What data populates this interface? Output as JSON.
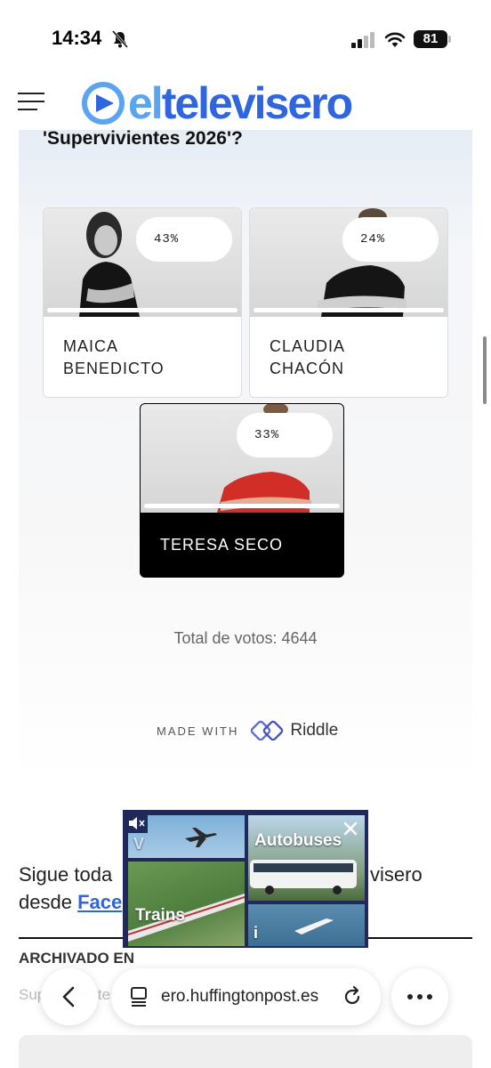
{
  "status_bar": {
    "time": "14:34",
    "battery": "81"
  },
  "header": {
    "logo_prefix": "el",
    "logo_main": "televisero"
  },
  "poll": {
    "title": "'Supervivientes 2026'?",
    "options": [
      {
        "line1": "MAICA",
        "line2": "BENEDICTO",
        "percent_label": "43%",
        "percent": 43
      },
      {
        "line1": "CLAUDIA",
        "line2": "CHACÓN",
        "percent_label": "24%",
        "percent": 24
      },
      {
        "line1": "TERESA SECO",
        "line2": "",
        "percent_label": "33%",
        "percent": 33,
        "selected": true
      }
    ],
    "total_votes": "Total de votos: 4644",
    "made_with": "MADE WITH",
    "brand": "Riddle"
  },
  "article": {
    "follow_text_start": "Sigue toda",
    "follow_text_end": "visero",
    "follow_line2": "desde",
    "follow_link": "Face",
    "archived_label": "ARCHIVADO EN",
    "archived_tags": "Supervivientes"
  },
  "ad": {
    "word_autobuses": "Autobuses",
    "word_trains": "Trains",
    "letter_v": "V",
    "letter_i": "i"
  },
  "browser": {
    "url": "ero.huffingtonpost.es"
  },
  "colors": {
    "brand_blue": "#2f66e0",
    "brand_light_blue": "#5aa4f0",
    "selected_option": "#000000"
  }
}
